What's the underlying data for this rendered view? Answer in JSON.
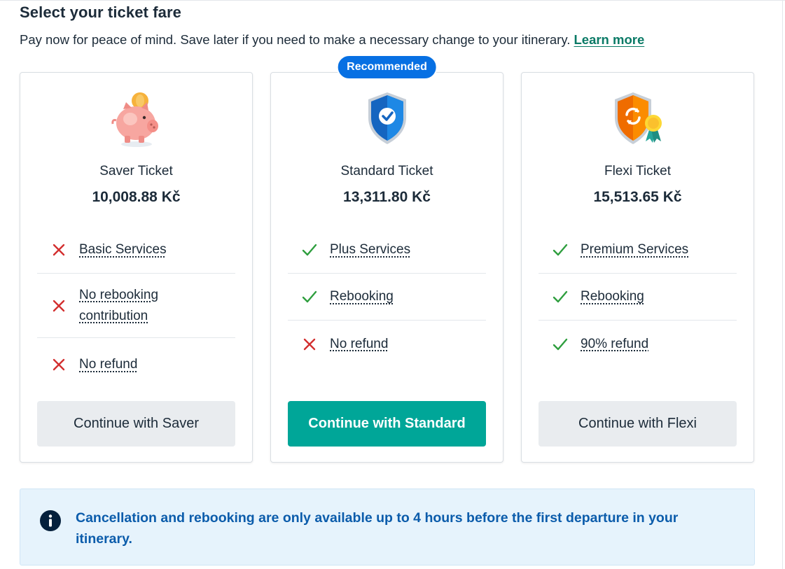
{
  "header": {
    "title": "Select your ticket fare",
    "subtitle": "Pay now for peace of mind. Save later if you need to make a necessary change to your itinerary.",
    "learn_more": "Learn more"
  },
  "fares": [
    {
      "name": "Saver Ticket",
      "price": "10,008.88 Kč",
      "illustration": "piggy-bank-icon",
      "features": [
        {
          "label": "Basic Services",
          "included": false
        },
        {
          "label": "No rebooking contribution",
          "included": false
        },
        {
          "label": "No refund",
          "included": false
        }
      ],
      "cta": "Continue with Saver"
    },
    {
      "name": "Standard Ticket",
      "price": "13,311.80 Kč",
      "badge": "Recommended",
      "illustration": "shield-check-icon",
      "features": [
        {
          "label": "Plus Services",
          "included": true
        },
        {
          "label": "Rebooking",
          "included": true
        },
        {
          "label": "No refund",
          "included": false
        }
      ],
      "cta": "Continue with Standard"
    },
    {
      "name": "Flexi Ticket",
      "price": "15,513.65 Kč",
      "illustration": "shield-refresh-award-icon",
      "features": [
        {
          "label": "Premium Services",
          "included": true
        },
        {
          "label": "Rebooking",
          "included": true
        },
        {
          "label": "90% refund",
          "included": true
        }
      ],
      "cta": "Continue with Flexi"
    }
  ],
  "notice": {
    "icon": "info-icon",
    "text": "Cancellation and rebooking are only available up to 4 hours before the first departure in your itinerary."
  },
  "colors": {
    "primary_cta": "#00a698",
    "badge": "#0770e3",
    "check": "#2e9e3e",
    "cross": "#d32f2f",
    "notice_bg": "#e6f3fc",
    "notice_text": "#0b5cab",
    "link": "#0a7a66"
  }
}
